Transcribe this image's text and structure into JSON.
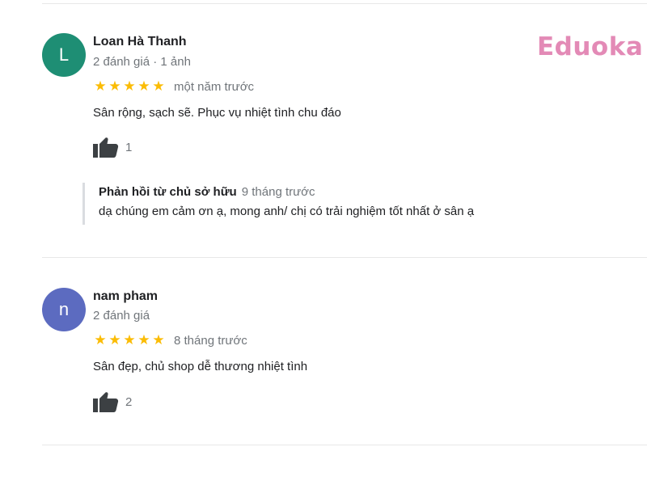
{
  "logo": {
    "text": "Eduoka"
  },
  "reviews": [
    {
      "avatar_letter": "L",
      "avatar_color": "#1e8e74",
      "name": "Loan Hà Thanh",
      "meta": "2 đánh giá · 1 ảnh",
      "stars": 5,
      "time": "một năm trước",
      "text": "Sân rộng, sạch sẽ. Phục vụ nhiệt tình chu đáo",
      "likes": "1",
      "reply": {
        "title": "Phản hồi từ chủ sở hữu",
        "time": "9 tháng trước",
        "text": "dạ chúng em cảm ơn ạ, mong anh/ chị có trải nghiệm tốt nhất ở sân ạ"
      }
    },
    {
      "avatar_letter": "n",
      "avatar_color": "#5c6bc0",
      "name": "nam pham",
      "meta": "2 đánh giá",
      "stars": 5,
      "time": "8 tháng trước",
      "text": "Sân đẹp, chủ shop dễ thương nhiệt tình",
      "likes": "2"
    }
  ],
  "colors": {
    "star": "#fbbc04",
    "logo": "#e38ab6",
    "secondary_text": "#70757a",
    "primary_text": "#202124"
  },
  "icons": {
    "star": "star-icon",
    "like": "thumbs-up-icon"
  }
}
